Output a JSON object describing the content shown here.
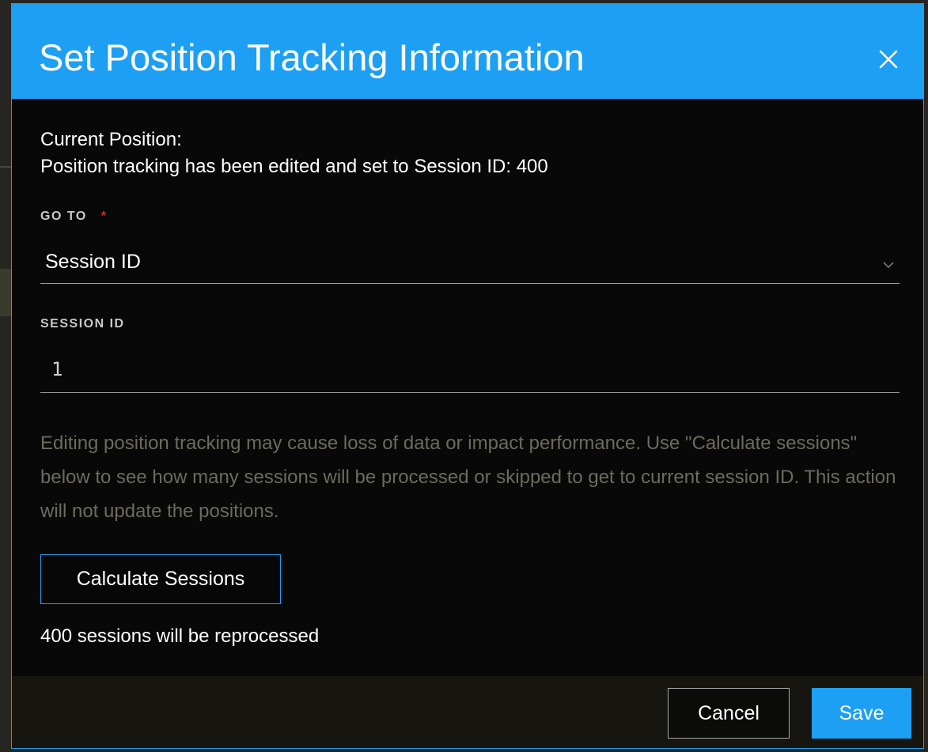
{
  "dialog": {
    "title": "Set Position Tracking Information",
    "close_icon": "close-icon",
    "accent_color": "#1d9ff3",
    "required_color": "#e0242c"
  },
  "current_position": {
    "label": "Current Position:",
    "text": "Position tracking has been edited and set to Session ID: 400"
  },
  "go_to": {
    "label": "GO TO",
    "required_marker": "*",
    "selected": "Session ID",
    "icon": "chevron-down-icon"
  },
  "session_id": {
    "label": "SESSION ID",
    "value": "1"
  },
  "warning": "Editing position tracking may cause loss of data or impact performance. Use \"Calculate sessions\" below to see how many sessions will be processed or skipped to get to current session ID. This action will not update the positions.",
  "calculate_button": "Calculate Sessions",
  "result": "400 sessions will be reprocessed",
  "footer": {
    "cancel_label": "Cancel",
    "save_label": "Save"
  }
}
